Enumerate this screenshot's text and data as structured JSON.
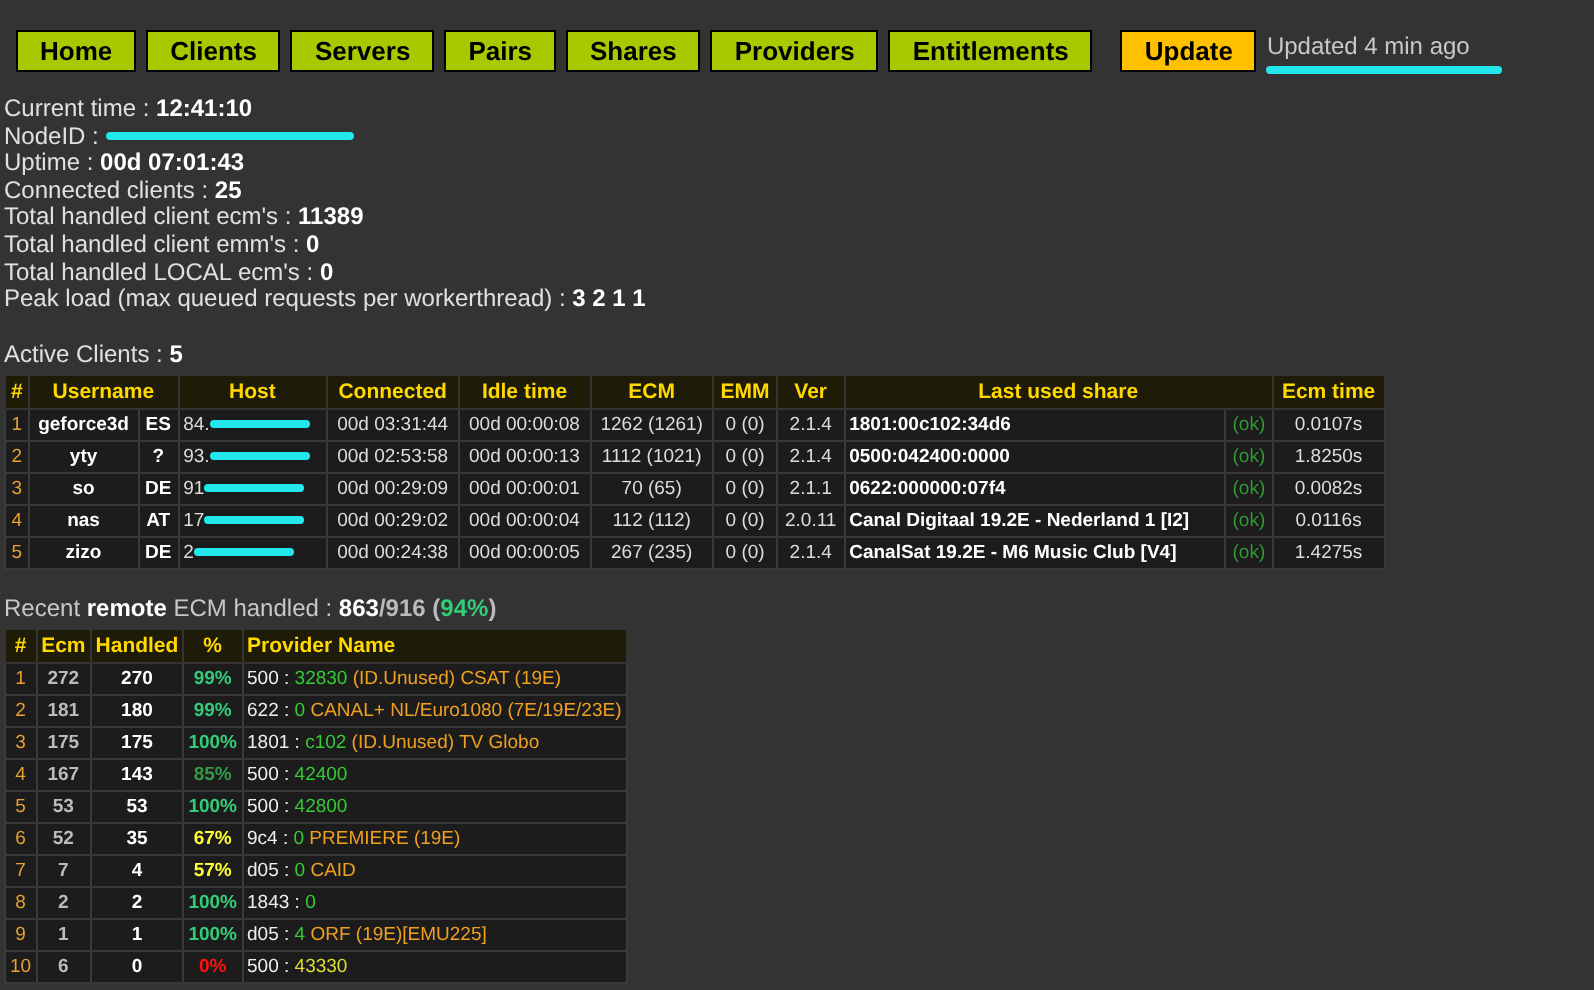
{
  "nav": [
    {
      "label": "Home",
      "kind": "nav"
    },
    {
      "label": "Clients",
      "kind": "nav"
    },
    {
      "label": "Servers",
      "kind": "nav"
    },
    {
      "label": "Pairs",
      "kind": "nav"
    },
    {
      "label": "Shares",
      "kind": "nav"
    },
    {
      "label": "Providers",
      "kind": "nav"
    },
    {
      "label": "Entitlements",
      "kind": "nav"
    },
    {
      "label": "Update",
      "kind": "update"
    }
  ],
  "updated": "Updated 4 min ago",
  "stats": [
    {
      "label": "Current time : ",
      "value": "12:41:10"
    },
    {
      "label": "NodeID : ",
      "redacted": true
    },
    {
      "label": "Uptime : ",
      "value": "00d 07:01:43"
    },
    {
      "label": "Connected clients : ",
      "value": "25"
    },
    {
      "label": "Total handled client ecm's : ",
      "value": "11389"
    },
    {
      "label": "Total handled client emm's : ",
      "value": "0"
    },
    {
      "label": "Total handled LOCAL ecm's : ",
      "value": "0"
    },
    {
      "label": "Peak load (max queued requests per workerthread) : ",
      "value": "3 2 1 1"
    }
  ],
  "clients": {
    "label": "Active Clients : ",
    "count": "5",
    "columns": [
      "#",
      "Username",
      "Host",
      "Connected",
      "Idle time",
      "ECM",
      "EMM",
      "Ver",
      "Last used share",
      "Ecm time"
    ],
    "rows": [
      {
        "n": "1",
        "username": "geforce3d",
        "country": "ES",
        "host": "84.",
        "connected": "00d 03:31:44",
        "idle": "00d 00:00:08",
        "ecm": "1262 (1261)",
        "emm": "0 (0)",
        "ver": "2.1.4",
        "share": "1801:00c102:34d6",
        "status": "(ok)",
        "ecm_time": "0.0107s"
      },
      {
        "n": "2",
        "username": "yty",
        "country": "?",
        "host": "93.",
        "connected": "00d 02:53:58",
        "idle": "00d 00:00:13",
        "ecm": "1112 (1021)",
        "emm": "0 (0)",
        "ver": "2.1.4",
        "share": "0500:042400:0000",
        "status": "(ok)",
        "ecm_time": "1.8250s"
      },
      {
        "n": "3",
        "username": "so",
        "country": "DE",
        "host": "91",
        "connected": "00d 00:29:09",
        "idle": "00d 00:00:01",
        "ecm": "70 (65)",
        "emm": "0 (0)",
        "ver": "2.1.1",
        "share": "0622:000000:07f4",
        "status": "(ok)",
        "ecm_time": "0.0082s"
      },
      {
        "n": "4",
        "username": "nas",
        "country": "AT",
        "host": "17",
        "connected": "00d 00:29:02",
        "idle": "00d 00:00:04",
        "ecm": "112 (112)",
        "emm": "0 (0)",
        "ver": "2.0.11",
        "share": "Canal Digitaal 19.2E - Nederland 1 [I2]",
        "status": "(ok)",
        "ecm_time": "0.0116s"
      },
      {
        "n": "5",
        "username": "zizo",
        "country": "DE",
        "host": "2",
        "connected": "00d 00:24:38",
        "idle": "00d 00:00:05",
        "ecm": "267 (235)",
        "emm": "0 (0)",
        "ver": "2.1.4",
        "share": "CanalSat 19.2E - M6 Music Club [V4]",
        "status": "(ok)",
        "ecm_time": "1.4275s"
      }
    ]
  },
  "recent": {
    "text": "Recent **remote** ECM handled : ",
    "handled": "863",
    "sep": "/",
    "total": "916",
    "open": " (",
    "pct": "94%",
    "close": ")",
    "columns": [
      "#",
      "Ecm",
      "Handled",
      "%",
      "Provider Name"
    ],
    "rows": [
      {
        "n": "1",
        "ecm": "272",
        "handled": "270",
        "pct": {
          "text": "99%",
          "color": "#33cc77"
        },
        "code": "500 : ",
        "id": {
          "text": "32830",
          "color": "#33cc33"
        },
        "name": " (ID.Unused) CSAT (19E)"
      },
      {
        "n": "2",
        "ecm": "181",
        "handled": "180",
        "pct": {
          "text": "99%",
          "color": "#33cc77"
        },
        "code": "622 : ",
        "id": {
          "text": "0",
          "color": "#33cc33"
        },
        "name": " CANAL+ NL/Euro1080 (7E/19E/23E)"
      },
      {
        "n": "3",
        "ecm": "175",
        "handled": "175",
        "pct": {
          "text": "100%",
          "color": "#33cc77"
        },
        "code": "1801 : ",
        "id": {
          "text": "c102",
          "color": "#33cc33"
        },
        "name": " (ID.Unused) TV Globo"
      },
      {
        "n": "4",
        "ecm": "167",
        "handled": "143",
        "pct": {
          "text": "85%",
          "color": "#339944"
        },
        "code": "500 : ",
        "id": {
          "text": "42400",
          "color": "#33cc33"
        }
      },
      {
        "n": "5",
        "ecm": "53",
        "handled": "53",
        "pct": {
          "text": "100%",
          "color": "#33cc77"
        },
        "code": "500 : ",
        "id": {
          "text": "42800",
          "color": "#33cc33"
        }
      },
      {
        "n": "6",
        "ecm": "52",
        "handled": "35",
        "pct": {
          "text": "67%",
          "color": "#ffff33"
        },
        "code": "9c4 : ",
        "id": {
          "text": "0",
          "color": "#33cc33"
        },
        "name": " PREMIERE (19E)"
      },
      {
        "n": "7",
        "ecm": "7",
        "handled": "4",
        "pct": {
          "text": "57%",
          "color": "#ffff33"
        },
        "code": "d05 : ",
        "id": {
          "text": "0",
          "color": "#33cc33"
        },
        "name": " CAID"
      },
      {
        "n": "8",
        "ecm": "2",
        "handled": "2",
        "pct": {
          "text": "100%",
          "color": "#33cc77"
        },
        "code": "1843 : ",
        "id": {
          "text": "0",
          "color": "#33cc33"
        }
      },
      {
        "n": "9",
        "ecm": "1",
        "handled": "1",
        "pct": {
          "text": "100%",
          "color": "#33cc77"
        },
        "code": "d05 : ",
        "id": {
          "text": "4",
          "color": "#33cc33"
        },
        "name": " ORF (19E)[EMU225]"
      },
      {
        "n": "10",
        "ecm": "6",
        "handled": "0",
        "pct": {
          "text": "0%",
          "color": "#ff1111"
        },
        "code": "500 : ",
        "id": {
          "text": "43330",
          "color": "#dddd33"
        }
      }
    ]
  }
}
